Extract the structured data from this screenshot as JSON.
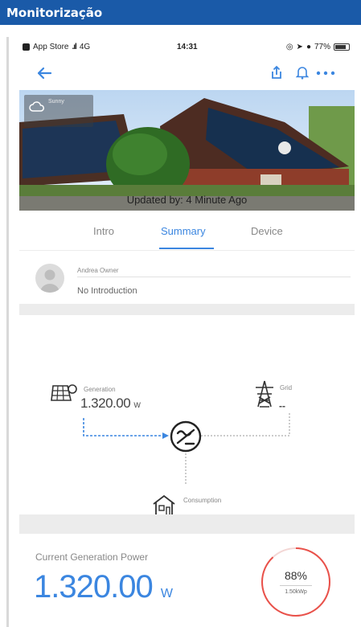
{
  "banner": {
    "title": "Monitorização"
  },
  "statusbar": {
    "carrier": "App Store",
    "network": "4G",
    "time": "14:31",
    "battery": "77%"
  },
  "hero": {
    "updated_text": "Updated by: 4 Minute Ago",
    "weather_text": "Sunny"
  },
  "tabs": [
    {
      "label": "Intro"
    },
    {
      "label": "Summary",
      "active": true
    },
    {
      "label": "Device"
    }
  ],
  "owner": {
    "label": "Andrea Owner",
    "intro": "No Introduction"
  },
  "flow": {
    "generation": {
      "label": "Generation",
      "value": "1.320.00",
      "unit": "W"
    },
    "grid": {
      "label": "Grid",
      "value": "--"
    },
    "consumption": {
      "label": "Consumption",
      "value": "--"
    }
  },
  "power": {
    "label": "Current Generation Power",
    "value": "1.320.00",
    "unit": "W",
    "gauge_percent": "88%",
    "gauge_fraction": 0.88,
    "gauge_caption": "1.50kWp"
  },
  "colors": {
    "banner": "#1a5aa8",
    "accent": "#3b86e0",
    "gauge": "#e9514a"
  },
  "icons": [
    "back-arrow-icon",
    "share-icon",
    "bell-icon",
    "more-icon",
    "solar-panel-icon",
    "pylon-icon",
    "house-icon",
    "inverter-icon",
    "weather-icon"
  ]
}
